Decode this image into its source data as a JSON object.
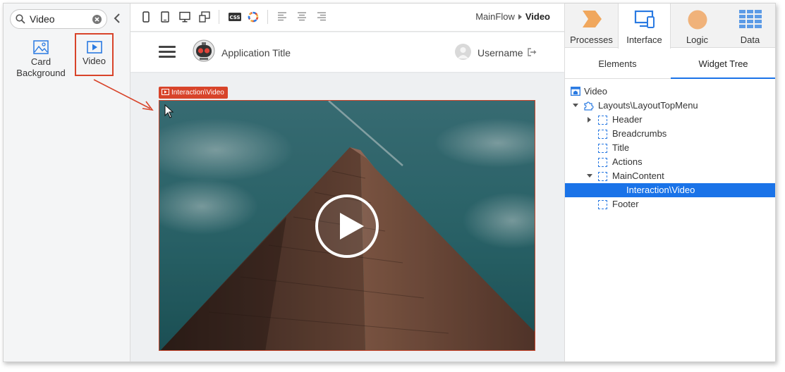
{
  "colors": {
    "accent": "#d8442a",
    "selection": "#1a73e8",
    "placeholder_outline": "#2a7ae2",
    "processes": "#f0a75d",
    "interface": "#2a7ae2",
    "logic": "#f0b27a",
    "data": "#5c9be6"
  },
  "toolbox": {
    "search": {
      "value": "Video",
      "placeholder": ""
    },
    "items": [
      {
        "label": "Card\nBackground",
        "icon": "image-icon"
      },
      {
        "label": "Video",
        "icon": "video-play-icon",
        "highlighted": true
      }
    ]
  },
  "toolbar": {
    "icons": [
      "phone-portrait-icon",
      "tablet-icon",
      "desktop-icon",
      "multi-device-icon",
      "css-icon",
      "theme-icon",
      "align-left-icon",
      "align-center-icon",
      "align-right-icon"
    ],
    "css_label": "CSS"
  },
  "breadcrumb": {
    "flow": "MainFlow",
    "current": "Video"
  },
  "app_header": {
    "title": "Application Title",
    "username": "Username"
  },
  "video_widget": {
    "label": "Interaction\\Video"
  },
  "module_tabs": [
    {
      "label": "Processes",
      "icon": "processes-icon"
    },
    {
      "label": "Interface",
      "icon": "interface-icon",
      "active": true
    },
    {
      "label": "Logic",
      "icon": "logic-icon"
    },
    {
      "label": "Data",
      "icon": "data-icon"
    }
  ],
  "sub_tabs": [
    {
      "label": "Elements"
    },
    {
      "label": "Widget Tree",
      "active": true
    }
  ],
  "widget_tree": [
    {
      "label": "Video",
      "icon": "screen-icon",
      "expander": "none",
      "selected": false
    },
    {
      "label": "Layouts\\LayoutTopMenu",
      "icon": "block-icon",
      "expander": "down",
      "selected": false
    },
    {
      "label": "Header",
      "icon": "placeholder-icon",
      "expander": "right",
      "selected": false
    },
    {
      "label": "Breadcrumbs",
      "icon": "placeholder-icon",
      "expander": "none",
      "selected": false
    },
    {
      "label": "Title",
      "icon": "placeholder-icon",
      "expander": "none",
      "selected": false
    },
    {
      "label": "Actions",
      "icon": "placeholder-icon",
      "expander": "none",
      "selected": false
    },
    {
      "label": "MainContent",
      "icon": "placeholder-icon",
      "expander": "down",
      "selected": false
    },
    {
      "label": "Interaction\\Video",
      "icon": "none",
      "expander": "none",
      "selected": true
    },
    {
      "label": "Footer",
      "icon": "placeholder-icon",
      "expander": "none",
      "selected": false
    }
  ]
}
